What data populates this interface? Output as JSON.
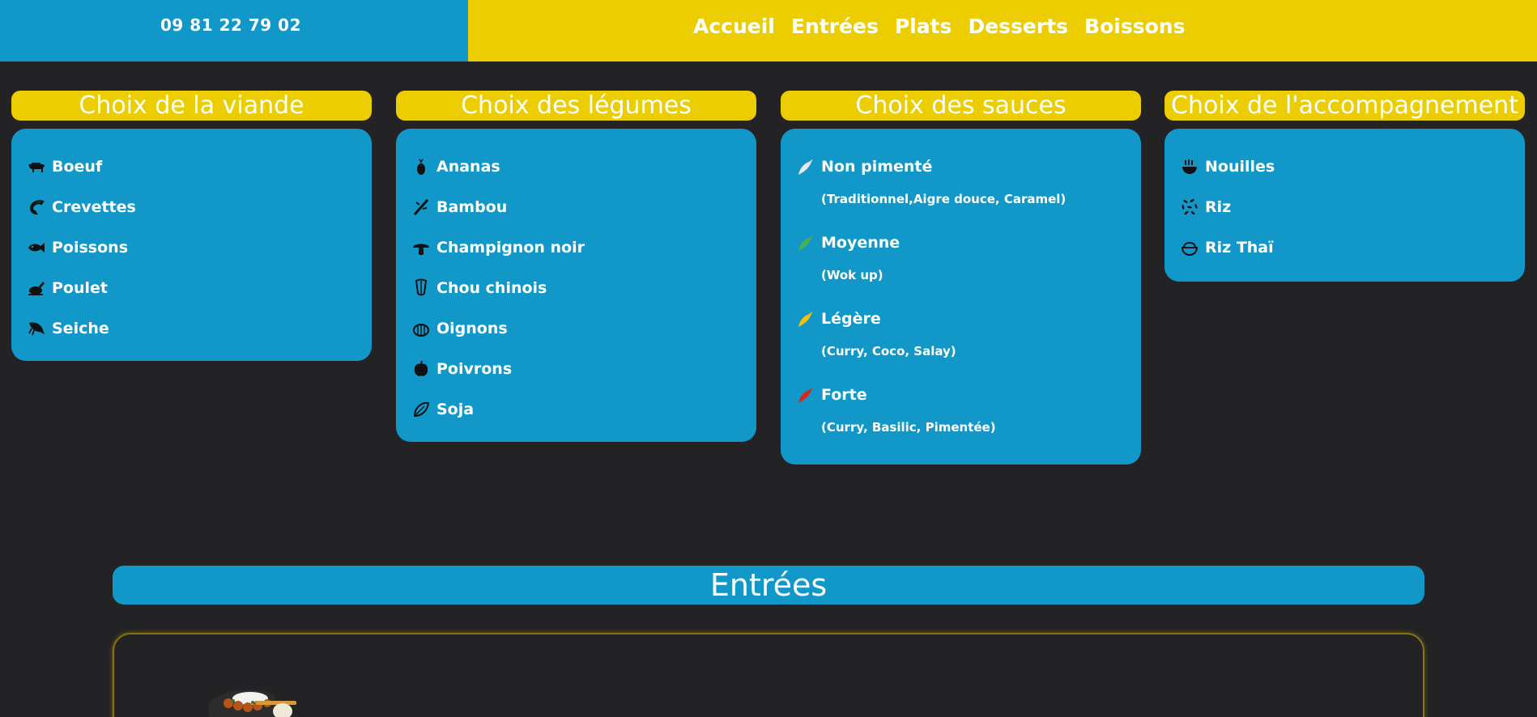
{
  "header": {
    "phone": "09 81 22 79 02",
    "nav": [
      "Accueil",
      "Entrées",
      "Plats",
      "Desserts",
      "Boissons"
    ]
  },
  "columns": [
    {
      "title": "Choix de la viande",
      "items": [
        {
          "label": "Boeuf",
          "icon": "cow-icon"
        },
        {
          "label": "Crevettes",
          "icon": "shrimp-icon"
        },
        {
          "label": "Poissons",
          "icon": "fish-icon"
        },
        {
          "label": "Poulet",
          "icon": "chicken-icon"
        },
        {
          "label": "Seiche",
          "icon": "squid-icon"
        }
      ]
    },
    {
      "title": "Choix des légumes",
      "items": [
        {
          "label": "Ananas",
          "icon": "pineapple-icon"
        },
        {
          "label": "Bambou",
          "icon": "bamboo-icon"
        },
        {
          "label": "Champignon noir",
          "icon": "mushroom-icon"
        },
        {
          "label": "Chou chinois",
          "icon": "cabbage-icon"
        },
        {
          "label": "Oignons",
          "icon": "onion-icon"
        },
        {
          "label": "Poivrons",
          "icon": "pepper-icon"
        },
        {
          "label": "Soja",
          "icon": "soy-icon"
        }
      ]
    },
    {
      "title": "Choix des sauces",
      "items": [
        {
          "label": "Non pimenté",
          "detail": "(Traditionnel,Aigre douce, Caramel)",
          "icon": "chili-white-icon",
          "color": "#e8e8e8"
        },
        {
          "label": "Moyenne",
          "detail": "(Wok up)",
          "icon": "chili-green-icon",
          "color": "#4caf50"
        },
        {
          "label": "Légère",
          "detail": "(Curry, Coco, Salay)",
          "icon": "chili-yellow-icon",
          "color": "#f2c200"
        },
        {
          "label": "Forte",
          "detail": "(Curry, Basilic, Pimentée)",
          "icon": "chili-red-icon",
          "color": "#d8261c"
        }
      ]
    },
    {
      "title": "Choix de l'accompagnement",
      "items": [
        {
          "label": "Nouilles",
          "icon": "noodles-icon"
        },
        {
          "label": "Riz",
          "icon": "rice-icon"
        },
        {
          "label": "Riz Thaï",
          "icon": "rice-bowl-icon"
        }
      ]
    }
  ],
  "section": {
    "title": "Entrées"
  },
  "colors": {
    "blue": "#1298c8",
    "yellow": "#ebcd00",
    "background": "#232325"
  }
}
